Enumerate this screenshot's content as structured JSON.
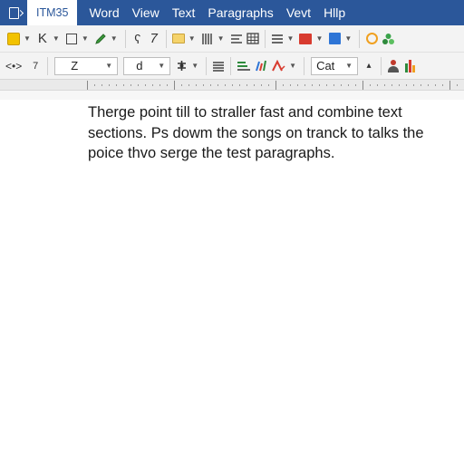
{
  "menubar": {
    "active_tab": "ITM35",
    "items": [
      "Word",
      "View",
      "Text",
      "Paragraphs",
      "Vevt",
      "Hllp"
    ]
  },
  "toolbar1": {
    "icons": [
      "clipboard-icon",
      "italic-k-icon",
      "border-icon",
      "pen-icon",
      "format-painter-icon",
      "italic-icon",
      "folder-icon",
      "columns-icon",
      "align-icon",
      "table-icon",
      "list-icon",
      "image-icon",
      "picture-icon",
      "search-icon",
      "share-icon"
    ],
    "bold_label": "K",
    "italic_label": "7",
    "cursor_label": "ʕ"
  },
  "toolbar2": {
    "undo_label": "<•>",
    "undo_count": "7",
    "font_select": "Z",
    "size_select": "d",
    "style_select": "Cat"
  },
  "document": {
    "lines": [
      "Therge point till to straller fast and combine text",
      "sections. Ps dowm the songs on tranck to talks the",
      "poice thvo serge the test paragraphs."
    ]
  },
  "colors": {
    "title_bar": "#2b579a",
    "toolbar_bg": "#f3f3f3",
    "ruler_bg": "#eaeaea",
    "page_bg": "#ffffff",
    "text": "#1a1a1a"
  }
}
